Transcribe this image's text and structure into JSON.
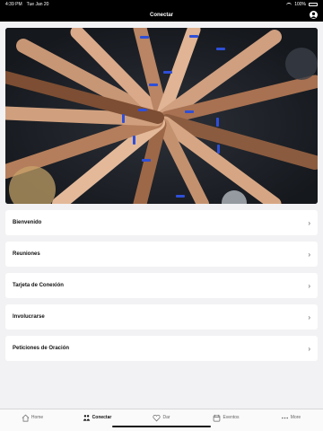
{
  "status": {
    "time": "4:39 PM",
    "date": "Tue Jan 20",
    "battery": "100%"
  },
  "nav": {
    "title": "Conectar"
  },
  "menu": [
    {
      "label": "Bienvenido"
    },
    {
      "label": "Reuniones"
    },
    {
      "label": "Tarjeta de Conexión"
    },
    {
      "label": "Involucrarse"
    },
    {
      "label": "Peticiones de Oración"
    }
  ],
  "tabs": [
    {
      "label": "Home",
      "icon": "house-icon"
    },
    {
      "label": "Conectar",
      "icon": "people-icon",
      "active": true
    },
    {
      "label": "Dar",
      "icon": "heart-icon"
    },
    {
      "label": "Eventos",
      "icon": "calendar-icon"
    },
    {
      "label": "More",
      "icon": "more-icon"
    }
  ]
}
